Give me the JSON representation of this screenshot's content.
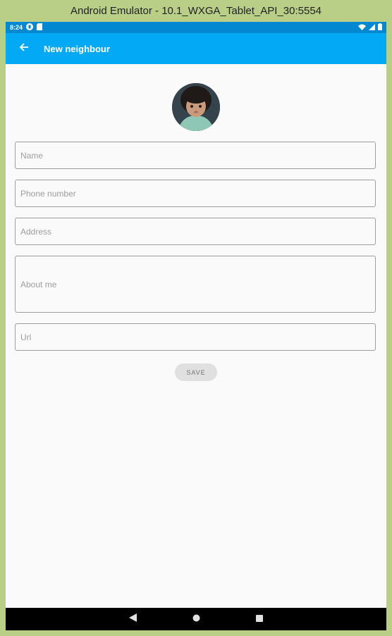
{
  "window": {
    "title": "Android Emulator - 10.1_WXGA_Tablet_API_30:5554"
  },
  "status_bar": {
    "time": "8:24"
  },
  "app_bar": {
    "title": "New neighbour"
  },
  "form": {
    "name": {
      "placeholder": "Name",
      "value": ""
    },
    "phone": {
      "placeholder": "Phone number",
      "value": ""
    },
    "address": {
      "placeholder": "Address",
      "value": ""
    },
    "about": {
      "placeholder": "About me",
      "value": ""
    },
    "url": {
      "placeholder": "Url",
      "value": ""
    },
    "save_label": "SAVE"
  },
  "colors": {
    "status_bar": "#0288d1",
    "app_bar": "#03a9f4",
    "background": "#fafafa",
    "emulator_frame": "#b9cf87"
  },
  "icons": {
    "back": "arrow-left-icon",
    "nav_back": "triangle-back-icon",
    "nav_home": "circle-home-icon",
    "nav_recents": "square-recents-icon"
  }
}
